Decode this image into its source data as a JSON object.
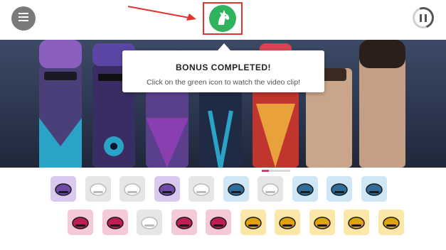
{
  "tooltip": {
    "title": "BONUS COMPLETED!",
    "message": "Click on the green icon to watch the video clip!"
  },
  "icons": {
    "menu": "hamburger-menu-icon",
    "pause": "pause-icon",
    "bonus": "horse-head-icon"
  },
  "colors": {
    "bonus_green": "#2fb35c",
    "highlight_red": "#e5342f",
    "progress_pink": "#e73a6a",
    "purple_tile": "#d9c9ee",
    "blue_tile": "#cfe6f4",
    "pink_tile": "#f6c9d9",
    "yellow_tile": "#fbe7a8",
    "grey_tile": "#e6e6e6"
  },
  "playback": {
    "progress_fraction": 0.25
  },
  "sound_icons": {
    "row1": [
      {
        "name": "purple-beanie",
        "tile": "purple"
      },
      {
        "name": "white-cap",
        "tile": "grey"
      },
      {
        "name": "white-cap-2",
        "tile": "grey"
      },
      {
        "name": "purple-goggles",
        "tile": "purple"
      },
      {
        "name": "white-glasses",
        "tile": "grey"
      },
      {
        "name": "blue-disc",
        "tile": "blue"
      },
      {
        "name": "white-disc",
        "tile": "grey"
      },
      {
        "name": "headphones",
        "tile": "blue"
      },
      {
        "name": "blue-beanie",
        "tile": "blue"
      },
      {
        "name": "blue-visor",
        "tile": "blue"
      }
    ],
    "row2": [
      {
        "name": "pink-lips",
        "tile": "pink"
      },
      {
        "name": "pink-hair",
        "tile": "pink"
      },
      {
        "name": "white-hair",
        "tile": "grey"
      },
      {
        "name": "pink-bandana",
        "tile": "pink"
      },
      {
        "name": "pink-hair-2",
        "tile": "pink"
      },
      {
        "name": "yellow-shirt",
        "tile": "yellow"
      },
      {
        "name": "yellow-hat",
        "tile": "yellow"
      },
      {
        "name": "yellow-sunglasses",
        "tile": "yellow"
      },
      {
        "name": "yellow-cap",
        "tile": "yellow"
      },
      {
        "name": "yellow-shades",
        "tile": "yellow"
      }
    ]
  }
}
